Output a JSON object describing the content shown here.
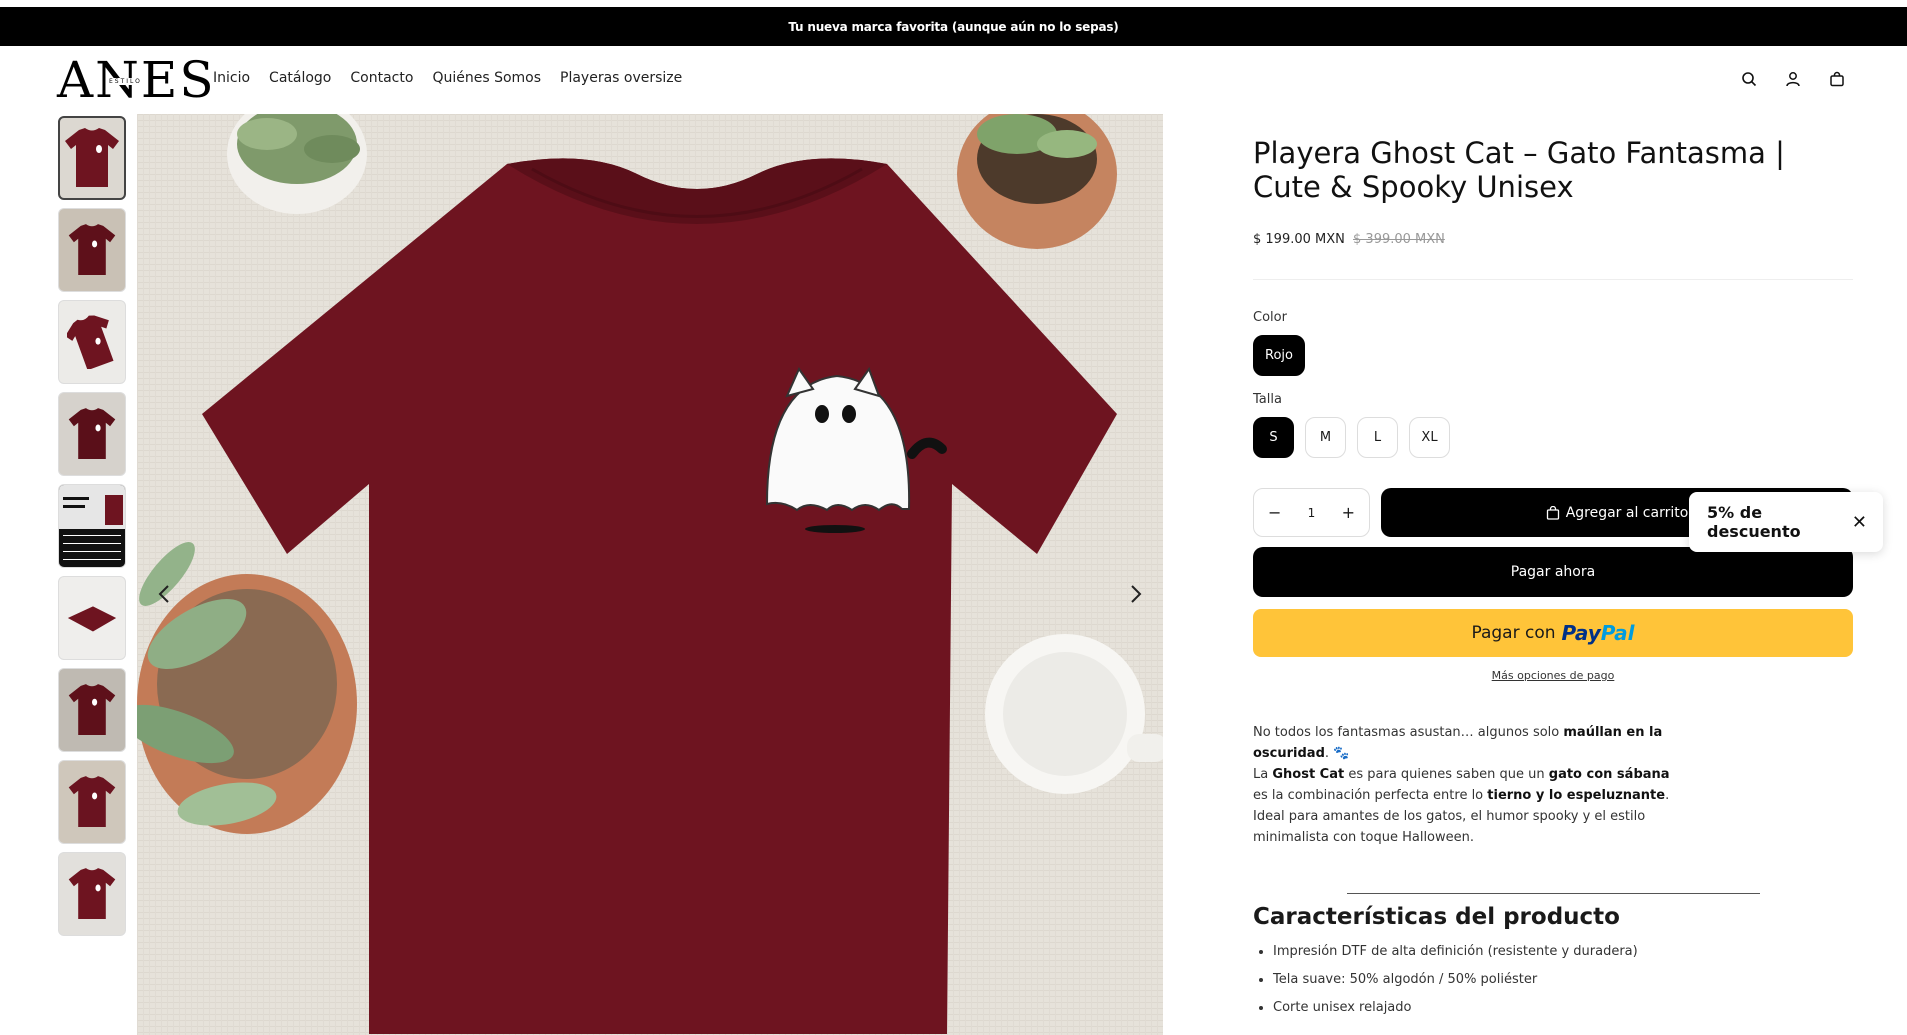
{
  "announcement": "Tu nueva marca favorita (aunque aún no lo sepas)",
  "logo": {
    "main": "ANES",
    "sub": "ESTILO"
  },
  "nav": [
    "Inicio",
    "Catálogo",
    "Contacto",
    "Quiénes Somos",
    "Playeras oversize"
  ],
  "header_icons": [
    "search-icon",
    "account-icon",
    "cart-icon"
  ],
  "product": {
    "title": "Playera Ghost Cat – Gato Fantasma | Cute & Spooky Unisex",
    "price": "$ 199.00 MXN",
    "compare_price": "$ 399.00 MXN",
    "color_label": "Color",
    "colors": [
      "Rojo"
    ],
    "selected_color": "Rojo",
    "size_label": "Talla",
    "sizes": [
      "S",
      "M",
      "L",
      "XL"
    ],
    "selected_size": "S",
    "quantity": "1",
    "add_to_cart": "Agregar al carrito",
    "buy_now": "Pagar ahora",
    "paypal_prefix": "Pagar con",
    "paypal_brand_a": "Pay",
    "paypal_brand_b": "Pal",
    "more_payment": "Más opciones de pago",
    "description": {
      "p1a": "No todos los fantasmas asustan… algunos solo ",
      "p1b": "maúllan en la oscuridad",
      "p1c": ". 🐾",
      "p2a": "La ",
      "p2b": "Ghost Cat",
      "p2c": " es para quienes saben que un ",
      "p2d": "gato con sábana",
      "p2e": " es la combinación perfecta entre lo ",
      "p2f": "tierno y lo espeluznante",
      "p2g": ".",
      "p3": "Ideal para amantes de los gatos, el humor spooky y el estilo minimalista con toque Halloween."
    },
    "features_title": "Características del producto",
    "features": [
      "Impresión DTF de alta definición (resistente y duradera)",
      "Tela suave: 50% algodón / 50% poliéster",
      "Corte unisex relajado"
    ]
  },
  "discount_popup": "5% de descuento",
  "colors": {
    "shirt": "#6e1420",
    "accent_paypal": "#ffc439"
  }
}
